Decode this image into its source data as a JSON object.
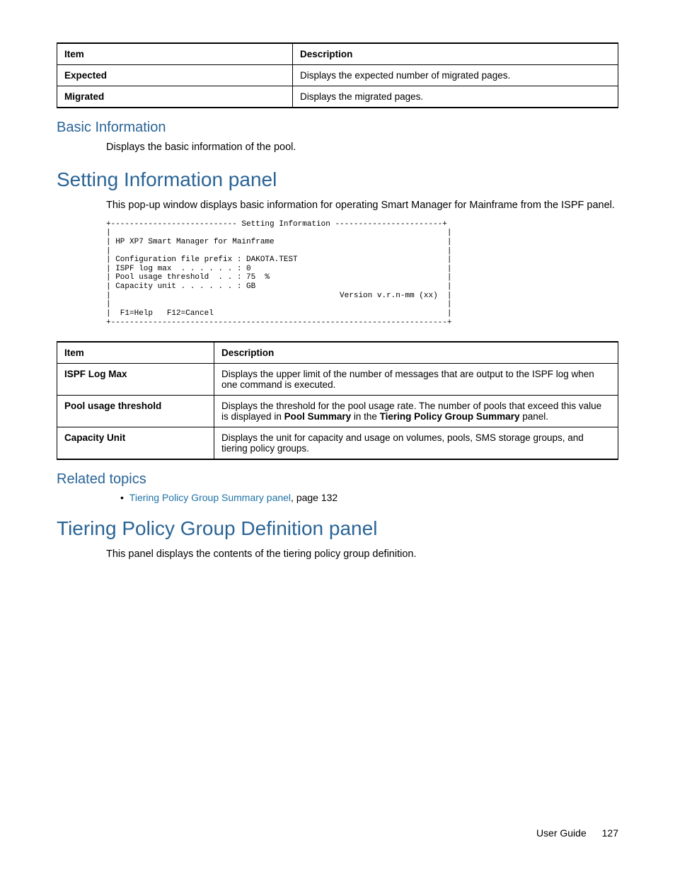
{
  "table1": {
    "header": {
      "c1": "Item",
      "c2": "Description"
    },
    "rows": [
      {
        "c1": "Expected",
        "c2": "Displays the expected number of migrated pages."
      },
      {
        "c1": "Migrated",
        "c2": "Displays the migrated pages."
      }
    ]
  },
  "basic": {
    "heading": "Basic Information",
    "text": "Displays the basic information of the pool."
  },
  "setting": {
    "heading": "Setting Information panel",
    "text": "This pop-up window displays basic information for operating Smart Manager for Mainframe from the ISPF panel.",
    "code": "+--------------------------- Setting Information -----------------------+\n|                                                                        |\n| HP XP7 Smart Manager for Mainframe                                     |\n|                                                                        |\n| Configuration file prefix : DAKOTA.TEST                                |\n| ISPF log max  . . . . . . : 0                                          |\n| Pool usage threshold  . . : 75  %                                      |\n| Capacity unit . . . . . . : GB                                         |\n|                                                 Version v.r.n-mm (xx)  |\n|                                                                        |\n|  F1=Help   F12=Cancel                                                  |\n+------------------------------------------------------------------------+"
  },
  "table2": {
    "header": {
      "c1": "Item",
      "c2": "Description"
    },
    "rows": [
      {
        "c1": "ISPF Log Max",
        "c2": "Displays the upper limit of the number of messages that are output to the ISPF log when one command is executed."
      },
      {
        "c1": "Pool usage threshold",
        "c2_pre": "Displays the threshold for the pool usage rate. The number of pools that exceed this value is displayed in ",
        "c2_b1": "Pool Summary",
        "c2_mid": " in the ",
        "c2_b2": "Tiering Policy Group Summary",
        "c2_post": " panel."
      },
      {
        "c1": "Capacity Unit",
        "c2": "Displays the unit for capacity and usage on volumes, pools, SMS storage groups, and tiering policy groups."
      }
    ]
  },
  "related": {
    "heading": "Related topics",
    "link": "Tiering Policy Group Summary panel",
    "suffix": ", page 132"
  },
  "tiering": {
    "heading": "Tiering Policy Group Definition panel",
    "text": "This panel displays the contents of the tiering policy group definition."
  },
  "footer": {
    "doc": "User Guide",
    "page": "127"
  }
}
